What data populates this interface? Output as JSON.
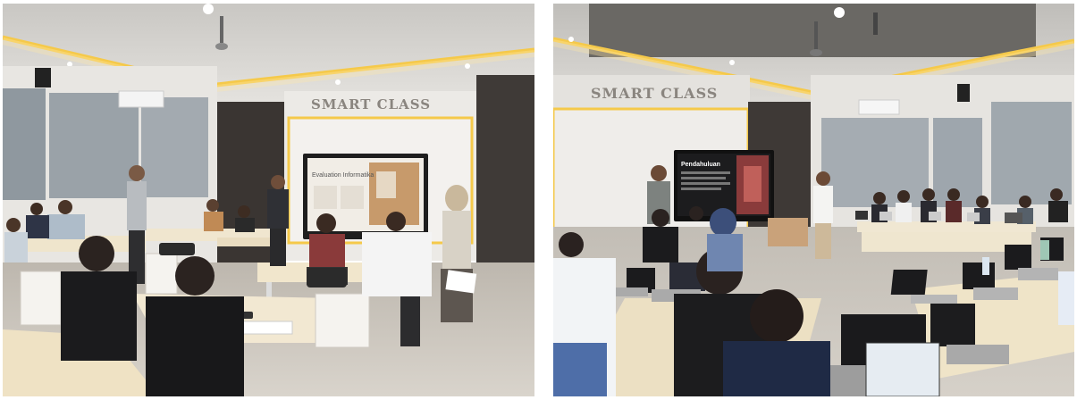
{
  "photos": [
    {
      "sign_text": "SMART CLASS",
      "slide_title": "Evaluation Informatika"
    },
    {
      "sign_text": "SMART CLASS",
      "slide_title": "Pendahuluan"
    }
  ],
  "colors": {
    "accent_led": "#f5c94a",
    "wall": "#e9e6e2",
    "ceiling": "#dcdad6",
    "floor": "#cfcac3",
    "desk": "#efe3c8",
    "curtain": "#4a4440"
  }
}
